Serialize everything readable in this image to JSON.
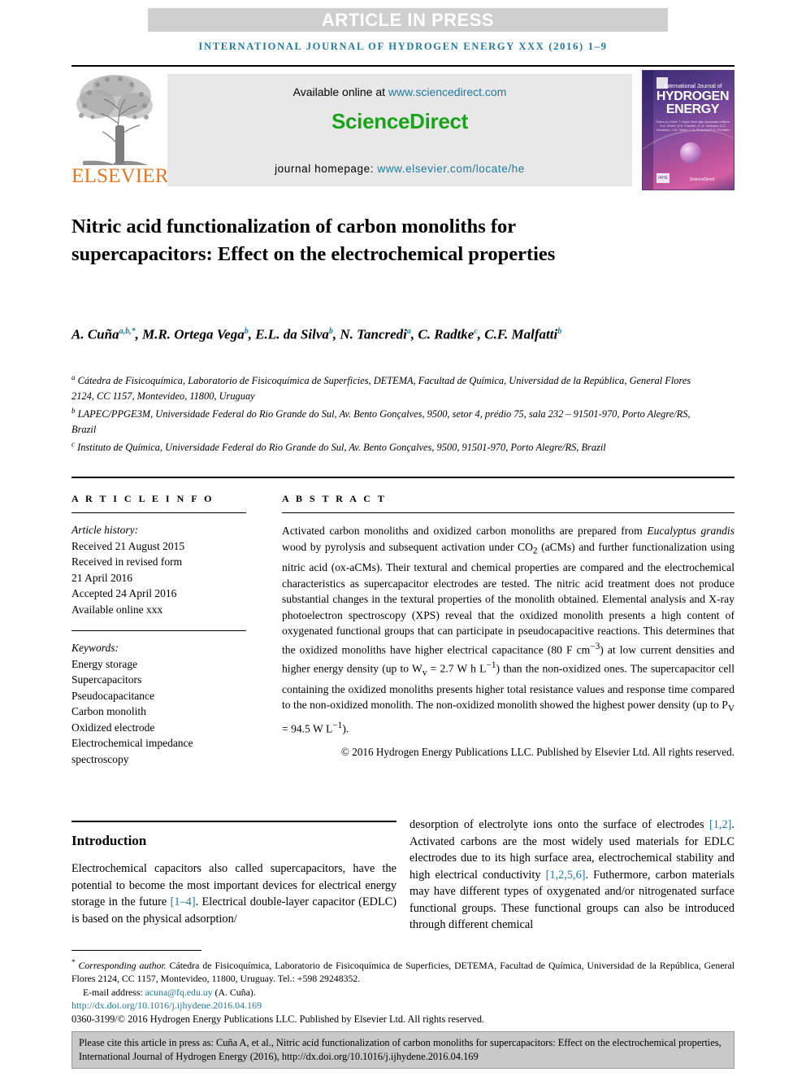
{
  "banner": {
    "article_in_press": "ARTICLE IN PRESS",
    "running_head": "INTERNATIONAL JOURNAL OF HYDROGEN ENERGY XXX (2016) 1–9"
  },
  "masthead": {
    "publisher_name": "ELSEVIER",
    "available_online_prefix": "Available online at ",
    "available_online_url": "www.sciencedirect.com",
    "sciencedirect_wordmark": "ScienceDirect",
    "homepage_prefix": "journal homepage: ",
    "homepage_url": "www.elsevier.com/locate/he",
    "cover": {
      "line1": "International Journal of",
      "line2": "HYDROGEN ENERGY",
      "editors": "Editor-in-Chief: T. Nejat Veziroğlu   Associate editors: S.A. Sherif, D.S. Franklin, S. A. Gennaro, A.C. Okonkwo, J.W. Tester, J. A. Ford and E.A. Fontaine",
      "imprint": "IAHE",
      "sciencedirect": "ScienceDirect"
    }
  },
  "article": {
    "title": "Nitric acid functionalization of carbon monoliths for supercapacitors: Effect on the electrochemical properties",
    "authors": [
      {
        "name": "A. Cuña",
        "marks": "a,b,*"
      },
      {
        "name": "M.R. Ortega Vega",
        "marks": "b"
      },
      {
        "name": "E.L. da Silva",
        "marks": "b"
      },
      {
        "name": "N. Tancredi",
        "marks": "a"
      },
      {
        "name": "C. Radtke",
        "marks": "c"
      },
      {
        "name": "C.F. Malfatti",
        "marks": "b"
      }
    ],
    "affiliations": [
      {
        "marker": "a",
        "text": "Cátedra de Fisicoquímica, Laboratorio de Fisicoquímica de Superficies, DETEMA, Facultad de Química, Universidad de la República, General Flores 2124, CC 1157, Montevideo, 11800, Uruguay"
      },
      {
        "marker": "b",
        "text": "LAPEC/PPGE3M, Universidade Federal do Rio Grande do Sul, Av. Bento Gonçalves, 9500, setor 4, prédio 75, sala 232 – 91501-970, Porto Alegre/RS, Brazil"
      },
      {
        "marker": "c",
        "text": "Instituto de Química, Universidade Federal do Rio Grande do Sul, Av. Bento Gonçalves, 9500, 91501-970, Porto Alegre/RS, Brazil"
      }
    ]
  },
  "article_info": {
    "heading": "A R T I C L E   I N F O",
    "history_label": "Article history:",
    "history": [
      "Received 21 August 2015",
      "Received in revised form",
      "21 April 2016",
      "Accepted 24 April 2016",
      "Available online xxx"
    ],
    "keywords_label": "Keywords:",
    "keywords": [
      "Energy storage",
      "Supercapacitors",
      "Pseudocapacitance",
      "Carbon monolith",
      "Oxidized electrode",
      "Electrochemical impedance",
      "spectroscopy"
    ]
  },
  "abstract": {
    "heading": "A B S T R A C T",
    "part1": "Activated carbon monoliths and oxidized carbon monoliths are prepared from ",
    "italic1": "Eucalyptus grandis",
    "part2": " wood by pyrolysis and subsequent activation under CO",
    "sub_co2": "2",
    "part3": " (aCMs) and further functionalization using nitric acid (ox-aCMs). Their textural and chemical properties are compared and the electrochemical characteristics as supercapacitor electrodes are tested. The nitric acid treatment does not produce substantial changes in the textural properties of the monolith obtained. Elemental analysis and X-ray photoelectron spectroscopy (XPS) reveal that the oxidized monolith presents a high content of oxygenated functional groups that can participate in pseudocapacitive reactions. This determines that the oxidized monoliths have higher electrical capacitance (80 F cm",
    "sup_cm": "−3",
    "part4": ") at low current densities and higher energy density (up to W",
    "sub_v1": "v",
    "part5": " = 2.7 W h L",
    "sup_l1": "−1",
    "part6": ") than the non-oxidized ones. The supercapacitor cell containing the oxidized monoliths presents higher total resistance values and response time compared to the non-oxidized monolith. The non-oxidized monolith showed the highest power density (up to P",
    "sub_v2": "V",
    "part7": " = 94.5 W L",
    "sup_l2": "−1",
    "part8": ").",
    "copyright": "© 2016 Hydrogen Energy Publications LLC. Published by Elsevier Ltd. All rights reserved."
  },
  "introduction": {
    "heading": "Introduction",
    "left_1": "Electrochemical capacitors also called supercapacitors, have the potential to become the most important devices for electrical energy storage in the future ",
    "left_ref1": "[1–4]",
    "left_2": ". Electrical double-layer capacitor (EDLC) is based on the physical adsorption/",
    "right_1": "desorption of electrolyte ions onto the surface of electrodes ",
    "right_ref1": "[1,2]",
    "right_2": ". Activated carbons are the most widely used materials for EDLC electrodes due to its high surface area, electrochemical stability and high electrical conductivity ",
    "right_ref2": "[1,2,5,6]",
    "right_3": ". Futhermore, carbon materials may have different types of oxygenated and/or nitrogenated surface functional groups. These functional groups can also be introduced through different chemical"
  },
  "footnote": {
    "star": "*",
    "corresponding_label": "Corresponding author.",
    "corresponding_address": " Cátedra de Fisicoquímica, Laboratorio de Fisicoquímica de Superficies, DETEMA, Facultad de Química, Universidad de la República, General Flores 2124, CC 1157, Montevideo, 11800, Uruguay. Tel.: +598 29248352.",
    "email_label": "E-mail address: ",
    "email": "acuna@fq.edu.uy",
    "email_owner": " (A. Cuña).",
    "doi": "http://dx.doi.org/10.1016/j.ijhydene.2016.04.169",
    "issn_line": "0360-3199/© 2016 Hydrogen Energy Publications LLC. Published by Elsevier Ltd. All rights reserved."
  },
  "cite_box": {
    "text": "Please cite this article in press as: Cuña A, et al., Nitric acid functionalization of carbon monoliths for supercapacitors: Effect on the electrochemical properties, International Journal of Hydrogen Energy (2016), http://dx.doi.org/10.1016/j.ijhydene.2016.04.169"
  },
  "colors": {
    "link_teal": "#1f7a9e",
    "sciencedirect_green": "#19a319",
    "elsevier_orange": "#e87722",
    "banner_gray": "#cfcfcf",
    "cite_box_gray": "#c9c9c9"
  }
}
